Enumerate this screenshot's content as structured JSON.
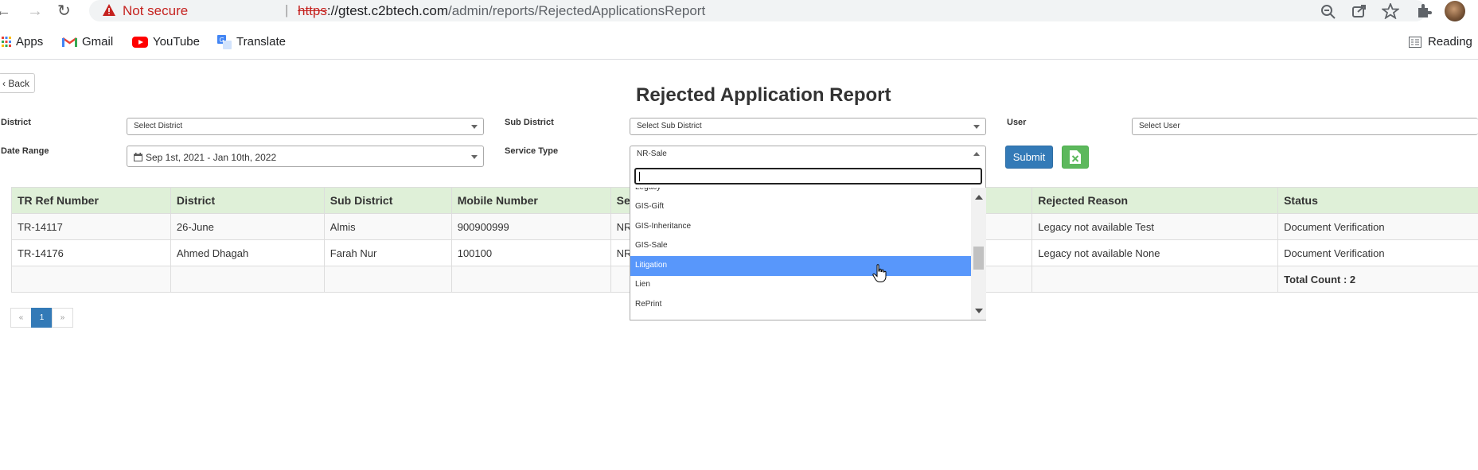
{
  "browser": {
    "not_secure": "Not secure",
    "separator": "|",
    "url_scheme": "https",
    "url_host": "://gtest.c2btech.com",
    "url_path": "/admin/reports/RejectedApplicationsReport",
    "bookmarks": [
      {
        "label": "Apps",
        "icon": "apps-grid-icon"
      },
      {
        "label": "Gmail",
        "icon": "gmail-icon"
      },
      {
        "label": "YouTube",
        "icon": "youtube-icon"
      },
      {
        "label": "Translate",
        "icon": "translate-icon"
      }
    ],
    "reading_list": "Reading"
  },
  "page": {
    "back_label": "Back",
    "title": "Rejected Application Report"
  },
  "filters": {
    "district_label": "District",
    "district_value": "Select District",
    "sub_district_label": "Sub District",
    "sub_district_value": "Select Sub District",
    "user_label": "User",
    "user_value": "Select User",
    "date_range_label": "Date Range",
    "date_range_value": "Sep 1st, 2021 - Jan 10th, 2022",
    "service_type_label": "Service Type",
    "service_type_value": "NR-Sale",
    "submit_label": "Submit"
  },
  "dropdown": {
    "search_value": "",
    "options": [
      "Legacy",
      "GIS-Gift",
      "GIS-Inheritance",
      "GIS-Sale",
      "Litigation",
      "Lien",
      "RePrint"
    ],
    "highlighted": "Litigation"
  },
  "table": {
    "headers": [
      "TR Ref Number",
      "District",
      "Sub District",
      "Mobile Number",
      "Se",
      "",
      "Rejected Reason",
      "Status"
    ],
    "rows": [
      [
        "TR-14117",
        "26-June",
        "Almis",
        "900900999",
        "NR",
        "",
        "Legacy not available Test",
        "Document Verification"
      ],
      [
        "TR-14176",
        "Ahmed Dhagah",
        "Farah Nur",
        "100100",
        "NR",
        "",
        "Legacy not available None",
        "Document Verification"
      ]
    ],
    "total_label": "Total Count : 2"
  },
  "pagination": {
    "prev": "«",
    "current": "1",
    "next": "»"
  },
  "colors": {
    "header_bg": "#dff0d8",
    "submit_bg": "#337ab7",
    "excel_bg": "#5cb85c",
    "highlight_bg": "#5897fb",
    "not_secure": "#c5221f"
  }
}
